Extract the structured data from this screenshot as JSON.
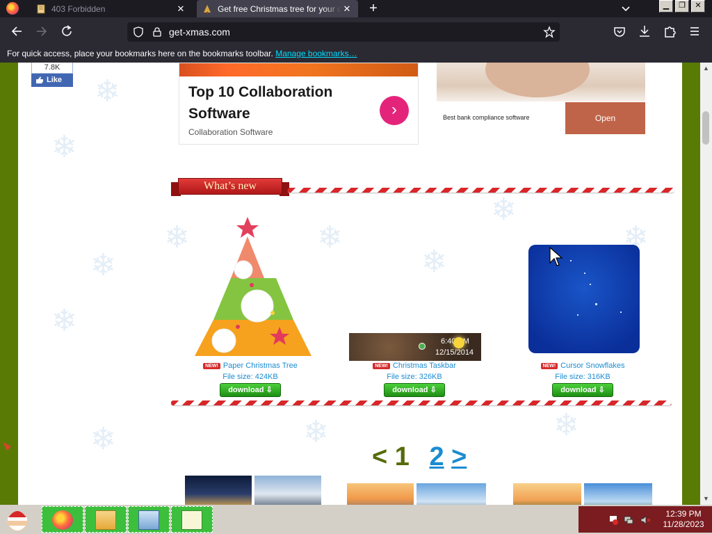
{
  "browser": {
    "tabs": [
      {
        "title": "403 Forbidden",
        "active": false
      },
      {
        "title": "Get free Christmas tree for your desktop",
        "active": true
      }
    ],
    "new_tab_symbol": "+",
    "close_symbol": "✕",
    "url": "get-xmas.com",
    "bookmarks_bar": {
      "text": "For quick access, place your bookmarks here on the bookmarks toolbar.",
      "link": "Manage bookmarks…"
    }
  },
  "page": {
    "fb": {
      "count": "7.8K",
      "like_label": "Like"
    },
    "ad1": {
      "title": "Top 10 Collaboration Software",
      "subtitle": "Collaboration Software",
      "arrow": "›"
    },
    "ad2": {
      "text": "Best bank compliance software",
      "button": "Open"
    },
    "section_title": "What’s new",
    "items": [
      {
        "badge": "NEW!",
        "name": "Paper Christmas Tree",
        "size": "File size: 424KB",
        "download": "download ⇩"
      },
      {
        "badge": "NEW!",
        "name": "Christmas Taskbar",
        "size": "File size: 326KB",
        "download": "download ⇩",
        "clock_time": "6:40 PM",
        "clock_date": "12/15/2014"
      },
      {
        "badge": "NEW!",
        "name": "Cursor Snowflakes",
        "size": "File size: 316KB",
        "download": "download ⇩"
      }
    ],
    "pager": {
      "prev": "< 1",
      "current": "2",
      "next": ">"
    }
  },
  "taskbar": {
    "time": "12:39 PM",
    "date": "11/28/2023"
  },
  "colors": {
    "page_bg": "#5a7a06",
    "link_blue": "#1b8cd1",
    "ribbon_red": "#d9262a",
    "download_green": "#2aa81e"
  }
}
